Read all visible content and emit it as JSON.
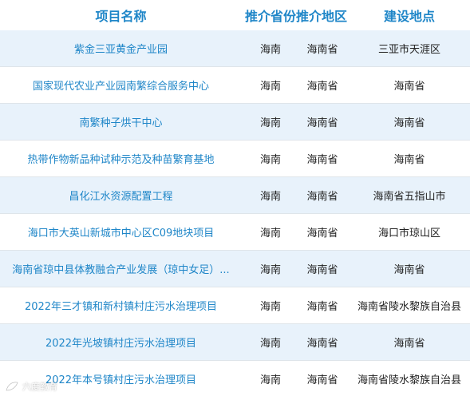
{
  "header": {
    "col_name": "项目名称",
    "col_province": "推介省份",
    "col_area": "推介地区",
    "col_site": "建设地点"
  },
  "rows": [
    {
      "name": "紫金三亚黄金产业园",
      "province": "海南",
      "area": "海南省",
      "site": "三亚市天涯区"
    },
    {
      "name": "国家现代农业产业园南繁综合服务中心",
      "province": "海南",
      "area": "海南省",
      "site": "海南省"
    },
    {
      "name": "南繁种子烘干中心",
      "province": "海南",
      "area": "海南省",
      "site": "海南省"
    },
    {
      "name": "热带作物新品种试种示范及种苗繁育基地",
      "province": "海南",
      "area": "海南省",
      "site": "海南省"
    },
    {
      "name": "昌化江水资源配置工程",
      "province": "海南",
      "area": "海南省",
      "site": "海南省五指山市"
    },
    {
      "name": "海口市大英山新城市中心区C09地块项目",
      "province": "海南",
      "area": "海南省",
      "site": "海口市琼山区"
    },
    {
      "name": "海南省琼中县体教融合产业发展（琼中女足）...",
      "province": "海南",
      "area": "海南省",
      "site": "海南省"
    },
    {
      "name": "2022年三才镇和新村镇村庄污水治理项目",
      "province": "海南",
      "area": "海南省",
      "site": "海南省陵水黎族自治县"
    },
    {
      "name": "2022年光坡镇村庄污水治理项目",
      "province": "海南",
      "area": "海南省",
      "site": "海南省"
    },
    {
      "name": "2022年本号镇村庄污水治理项目",
      "province": "海南",
      "area": "海南省",
      "site": "海南省陵水黎族自治县"
    }
  ],
  "watermark": {
    "text": "六度教育",
    "icon": "leaf-logo-icon"
  },
  "colors": {
    "link_blue": "#1f86c8",
    "row_shade": "#e8f2fb",
    "row_border": "#dfe5ea"
  }
}
